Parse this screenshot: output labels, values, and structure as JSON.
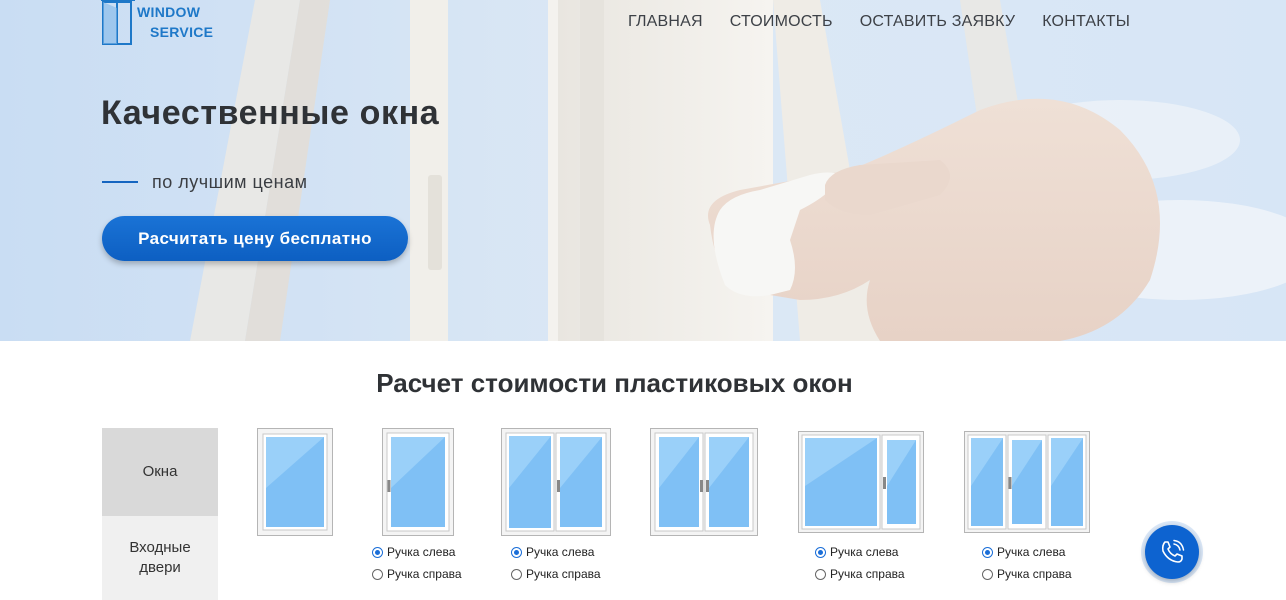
{
  "brand": {
    "line1": "WINDOW",
    "line2": "SERVICE",
    "color": "#1e78c8"
  },
  "nav": {
    "items": [
      "ГЛАВНАЯ",
      "СТОИМОСТЬ",
      "ОСТАВИТЬ ЗАЯВКУ",
      "КОНТАКТЫ"
    ]
  },
  "hero": {
    "title": "Качественные окна",
    "subtitle": "по лучшим ценам",
    "cta": "Расчитать цену бесплатно",
    "accent": "#1565c0"
  },
  "calculator": {
    "title": "Расчет стоимости пластиковых окон",
    "tabs": [
      "Окна",
      "Входные двери"
    ],
    "options": [
      {
        "left": "Ручка слева",
        "right": "Ручка справа",
        "selected": "left"
      },
      {
        "left": "Ручка слева",
        "right": "Ручка справа",
        "selected": "left"
      },
      {
        "left": "Ручка слева",
        "right": "Ручка справа",
        "selected": "left"
      },
      {
        "left": "Ручка слева",
        "right": "Ручка справа",
        "selected": "left"
      }
    ]
  },
  "icons": {
    "call": "phone-call-icon",
    "logo": "window-logo-icon"
  }
}
